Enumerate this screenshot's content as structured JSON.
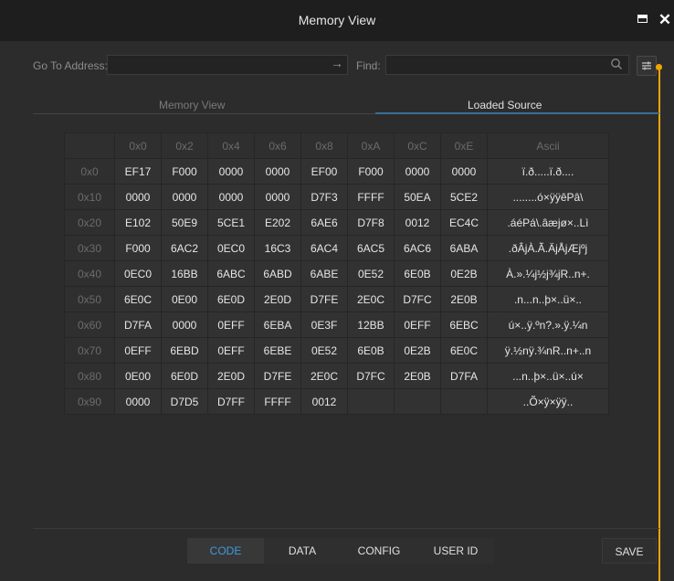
{
  "window": {
    "title": "Memory View"
  },
  "toolbar": {
    "address_label": "Go To Address:",
    "address_value": "",
    "find_label": "Find:",
    "find_value": ""
  },
  "tabs": [
    {
      "label": "Memory View",
      "active": false
    },
    {
      "label": "Loaded Source",
      "active": true
    }
  ],
  "grid": {
    "columns": [
      "0x0",
      "0x2",
      "0x4",
      "0x6",
      "0x8",
      "0xA",
      "0xC",
      "0xE",
      "Ascii"
    ],
    "rows": [
      {
        "addr": "0x0",
        "cells": [
          "EF17",
          "F000",
          "0000",
          "0000",
          "EF00",
          "F000",
          "0000",
          "0000"
        ],
        "ascii": "ï.ð.....ï.ð...."
      },
      {
        "addr": "0x10",
        "cells": [
          "0000",
          "0000",
          "0000",
          "0000",
          "D7F3",
          "FFFF",
          "50EA",
          "5CE2"
        ],
        "ascii": "........ó×ÿÿêPâ\\"
      },
      {
        "addr": "0x20",
        "cells": [
          "E102",
          "50E9",
          "5CE1",
          "E202",
          "6AE6",
          "D7F8",
          "0012",
          "EC4C"
        ],
        "ascii": ".áéPá\\.âæjø×..Lì"
      },
      {
        "addr": "0x30",
        "cells": [
          "F000",
          "6AC2",
          "0EC0",
          "16C3",
          "6AC4",
          "6AC5",
          "6AC6",
          "6ABA"
        ],
        "ascii": ".ðÂjÀ.Ã.ÄjÅjÆjºj"
      },
      {
        "addr": "0x40",
        "cells": [
          "0EC0",
          "16BB",
          "6ABC",
          "6ABD",
          "6ABE",
          "0E52",
          "6E0B",
          "0E2B"
        ],
        "ascii": "À.».¼j½j¾jR..n+."
      },
      {
        "addr": "0x50",
        "cells": [
          "6E0C",
          "0E00",
          "6E0D",
          "2E0D",
          "D7FE",
          "2E0C",
          "D7FC",
          "2E0B"
        ],
        "ascii": ".n...n..þ×..ü×.."
      },
      {
        "addr": "0x60",
        "cells": [
          "D7FA",
          "0000",
          "0EFF",
          "6EBA",
          "0E3F",
          "12BB",
          "0EFF",
          "6EBC"
        ],
        "ascii": "ú×..ÿ.ºn?.».ÿ.¼n"
      },
      {
        "addr": "0x70",
        "cells": [
          "0EFF",
          "6EBD",
          "0EFF",
          "6EBE",
          "0E52",
          "6E0B",
          "0E2B",
          "6E0C"
        ],
        "ascii": "ÿ.½nÿ.¾nR..n+..n"
      },
      {
        "addr": "0x80",
        "cells": [
          "0E00",
          "6E0D",
          "2E0D",
          "D7FE",
          "2E0C",
          "D7FC",
          "2E0B",
          "D7FA"
        ],
        "ascii": "...n..þ×..ü×..ú×"
      },
      {
        "addr": "0x90",
        "cells": [
          "0000",
          "D7D5",
          "D7FF",
          "FFFF",
          "0012",
          "",
          "",
          ""
        ],
        "ascii": "..Õ×ÿ×ÿÿ.."
      }
    ]
  },
  "footer": {
    "segments": [
      {
        "label": "CODE",
        "active": true
      },
      {
        "label": "DATA",
        "active": false
      },
      {
        "label": "CONFIG",
        "active": false
      },
      {
        "label": "USER ID",
        "active": false
      }
    ],
    "save_label": "SAVE"
  },
  "colors": {
    "accent": "#3d9be0",
    "marker": "#f0a500",
    "tab_underline": "#3b6e96"
  },
  "icons": {
    "go": "arrow-right-icon",
    "search": "search-icon",
    "filter": "filter-sliders-icon",
    "maximize": "maximize-icon",
    "close": "close-icon"
  }
}
